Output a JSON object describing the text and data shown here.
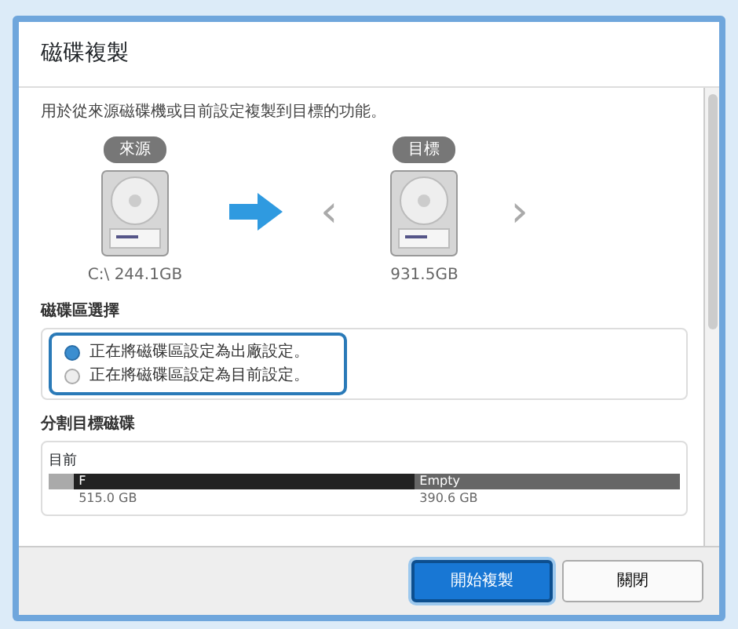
{
  "window": {
    "title": "磁碟複製"
  },
  "description": "用於從來源磁碟機或目前設定複製到目標的功能。",
  "source": {
    "badge": "來源",
    "label": "C:\\ 244.1GB"
  },
  "target": {
    "badge": "目標",
    "label": "931.5GB",
    "prev": "‹",
    "next": "›"
  },
  "options": {
    "title": "磁碟區選擇",
    "radios": [
      {
        "label": "正在將磁碟區設定為出廠設定。",
        "selected": true
      },
      {
        "label": "正在將磁碟區設定為目前設定。",
        "selected": false
      }
    ]
  },
  "partition": {
    "title": "分割目標磁碟",
    "caption": "目前",
    "segments": [
      {
        "kind": "reserved"
      },
      {
        "kind": "used",
        "label": "F",
        "size": "515.0 GB"
      },
      {
        "kind": "empty",
        "label": "Empty",
        "size": "390.6 GB"
      }
    ]
  },
  "buttons": [
    {
      "label": "開始複製",
      "primary": true
    },
    {
      "label": "關閉",
      "primary": false
    }
  ]
}
